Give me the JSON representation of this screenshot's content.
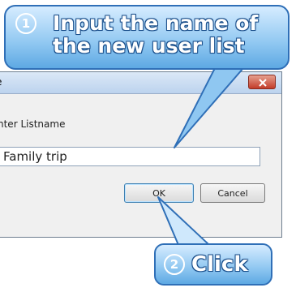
{
  "dialog": {
    "title": "e",
    "prompt": "nter Listname",
    "input_value": "Family trip",
    "ok_label": "OK",
    "cancel_label": "Cancel"
  },
  "callout1": {
    "number": "1",
    "line1": "Input the name of",
    "line2": "the new user list"
  },
  "callout2": {
    "number": "2",
    "text": "Click"
  },
  "icons": {
    "close": "close-icon"
  }
}
